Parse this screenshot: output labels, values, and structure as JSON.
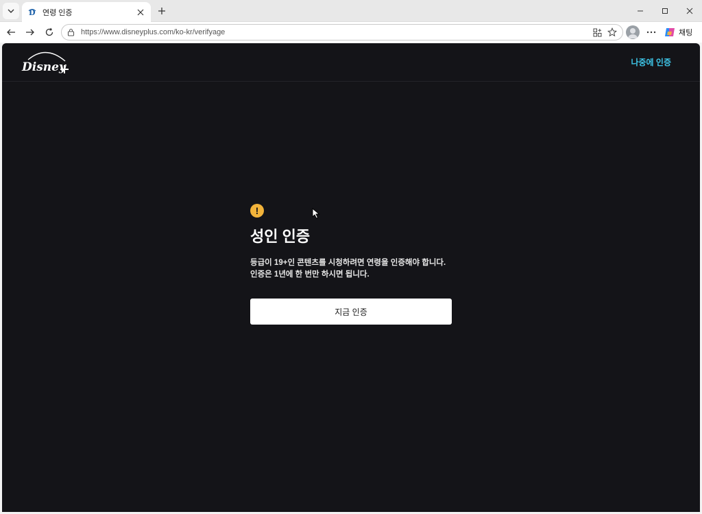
{
  "browser": {
    "tab_title": "연령 인증",
    "url": "https://www.disneyplus.com/ko-kr/verifyage",
    "copilot_label": "채팅"
  },
  "colors": {
    "accent": "#3ec6e8",
    "warning": "#f2b33a",
    "page_bg": "#141418"
  },
  "header": {
    "later_label": "나중에 인증"
  },
  "main": {
    "heading": "성인 인증",
    "description": "등급이 19+인 콘텐츠를 시청하려면 연령을 인증해야 합니다. 인증은 1년에 한 번만 하시면 됩니다.",
    "cta_label": "지금 인증",
    "warning_glyph": "!"
  }
}
